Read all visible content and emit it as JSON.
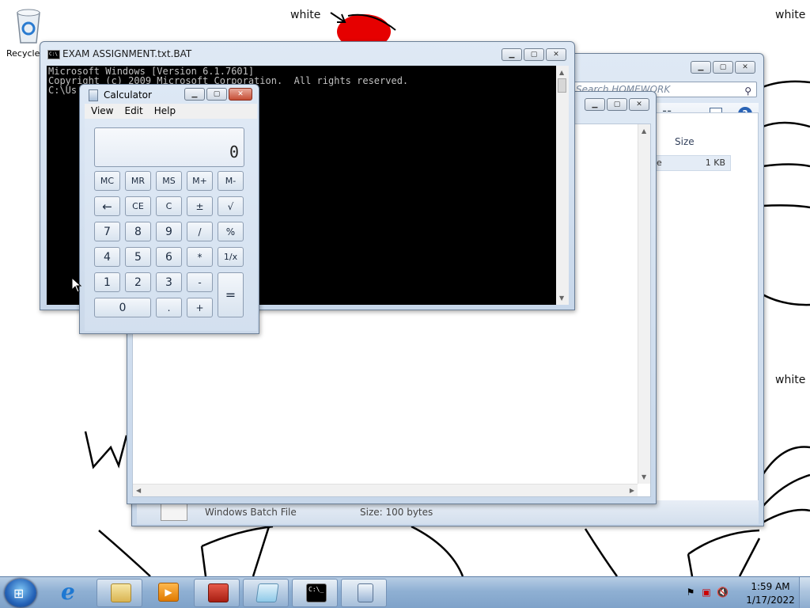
{
  "desktop": {
    "labels": [
      "white",
      "white",
      "white"
    ],
    "recycle_bin_label": "Recycle"
  },
  "explorer_back": {
    "search_placeholder": "Search HOMEWORK",
    "column_size": "Size",
    "file_name_fragment": "e",
    "file_size": "1 KB",
    "details_type": "Windows Batch File",
    "details_size": "Size: 100 bytes"
  },
  "cmd": {
    "title": "EXAM ASSIGNMENT.txt.BAT",
    "lines": [
      "Microsoft Windows [Version 6.1.7601]",
      "Copyright (c) 2009 Microsoft Corporation.  All rights reserved.",
      "",
      "C:\\Us"
    ]
  },
  "calculator": {
    "title": "Calculator",
    "menu": [
      "View",
      "Edit",
      "Help"
    ],
    "display": "0",
    "memory_keys": [
      "MC",
      "MR",
      "MS",
      "M+",
      "M-"
    ],
    "row2": [
      "←",
      "CE",
      "C",
      "±",
      "√"
    ],
    "row3": [
      "7",
      "8",
      "9",
      "/",
      "%"
    ],
    "row4": [
      "4",
      "5",
      "6",
      "*",
      "1/x"
    ],
    "row5": [
      "1",
      "2",
      "3",
      "-"
    ],
    "row6": [
      "0",
      ".",
      "+"
    ],
    "equals": "="
  },
  "taskbar": {
    "time": "1:59 AM",
    "date": "1/17/2022",
    "buttons": [
      "internet-explorer",
      "windows-explorer",
      "media-player",
      "toolbox",
      "notepad",
      "command-prompt",
      "calculator"
    ]
  },
  "colors": {
    "accent": "#2563b8",
    "console_bg": "#000000",
    "close_red": "#c54d35",
    "doodle_red": "#e60000"
  }
}
